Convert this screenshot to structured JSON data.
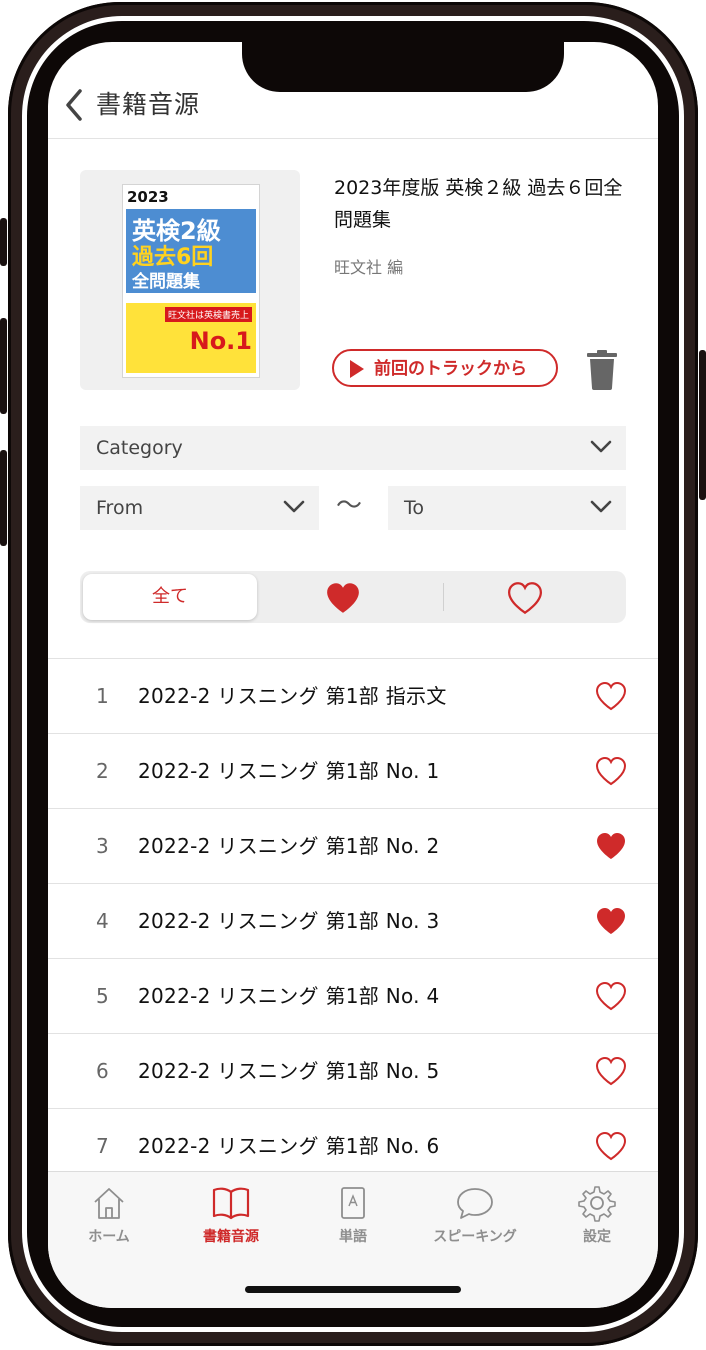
{
  "nav": {
    "title": "書籍音源",
    "back_icon": "chevron-left-icon"
  },
  "book": {
    "title": "2023年度版 英検２級 過去６回全問題集",
    "author": "旺文社 編",
    "cover": {
      "year": "2023",
      "line1": "英検2級",
      "line2": "過去6回",
      "line3": "全問題集",
      "badge": "旺文社は英検書売上",
      "no1": "No.1"
    },
    "resume_label": "前回のトラックから",
    "trash_icon": "trash-icon"
  },
  "filters": {
    "category": "Category",
    "from": "From",
    "separator": "〜",
    "to": "To"
  },
  "segment": {
    "all": "全て",
    "favorites_icon": "heart-filled-icon",
    "not_favorites_icon": "heart-outline-icon"
  },
  "tracks": [
    {
      "num": "1",
      "title": "2022-2 リスニング 第1部 指示文",
      "favorite": false
    },
    {
      "num": "2",
      "title": "2022-2 リスニング 第1部 No. 1",
      "favorite": false
    },
    {
      "num": "3",
      "title": "2022-2 リスニング 第1部 No. 2",
      "favorite": true
    },
    {
      "num": "4",
      "title": "2022-2 リスニング 第1部 No. 3",
      "favorite": true
    },
    {
      "num": "5",
      "title": "2022-2 リスニング 第1部 No. 4",
      "favorite": false
    },
    {
      "num": "6",
      "title": "2022-2 リスニング 第1部 No. 5",
      "favorite": false
    },
    {
      "num": "7",
      "title": "2022-2 リスニング 第1部 No. 6",
      "favorite": false
    }
  ],
  "tabbar": {
    "items": [
      {
        "label": "ホーム",
        "icon": "home-icon",
        "active": false
      },
      {
        "label": "書籍音源",
        "icon": "book-icon",
        "active": true
      },
      {
        "label": "単語",
        "icon": "word-card-icon",
        "active": false
      },
      {
        "label": "スピーキング",
        "icon": "speech-bubble-icon",
        "active": false
      },
      {
        "label": "設定",
        "icon": "gear-icon",
        "active": false
      }
    ]
  },
  "colors": {
    "accent": "#cf2a2a",
    "inactive": "#8e8e8e",
    "frame": "#2a1e1c"
  }
}
